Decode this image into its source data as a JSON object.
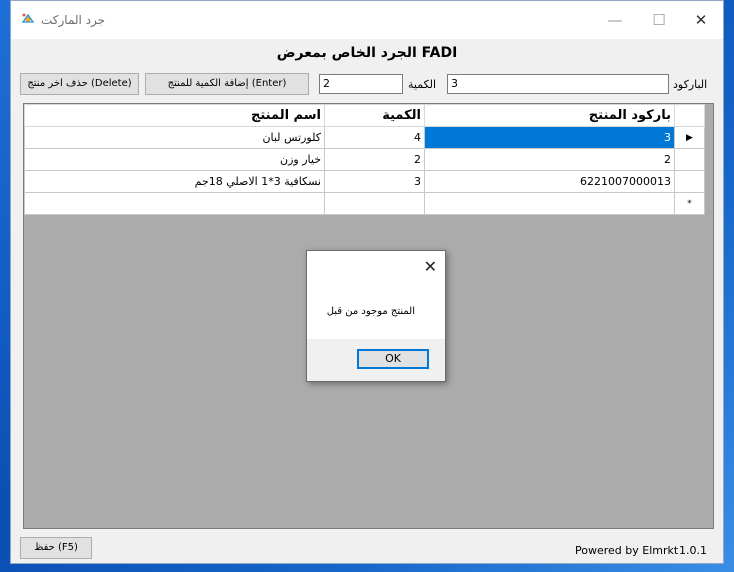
{
  "window": {
    "title": "جرد الماركت",
    "controls": {
      "minimize": "—",
      "maximize": "☐",
      "close": "✕"
    }
  },
  "header": {
    "title": "الجرد الخاص بمعرض FADI"
  },
  "form": {
    "barcode_label": "الباركود",
    "barcode_value": "3",
    "quantity_label": "الكمية",
    "quantity_value": "2",
    "add_button": "إضافة الكمية للمنتج (Enter)",
    "delete_button": "حذف اخر منتج (Delete)"
  },
  "grid": {
    "columns": [
      "باركود المنتج",
      "الكمية",
      "اسم المنتج"
    ],
    "rows": [
      {
        "barcode": "3",
        "quantity": "4",
        "name": "كلورتس لبان",
        "marker": "▶"
      },
      {
        "barcode": "2",
        "quantity": "2",
        "name": "خيار وزن",
        "marker": ""
      },
      {
        "barcode": "6221007000013",
        "quantity": "3",
        "name": "نسكافية 3*1 الاصلي 18جم",
        "marker": ""
      }
    ],
    "new_row_marker": "*"
  },
  "dialog": {
    "message": "المنتج موجود من قبل",
    "ok": "OK",
    "close": "✕"
  },
  "footer": {
    "save_button": "حفظ (F5)",
    "powered_by": "Powered by Elmrkt",
    "version": "1.0.1"
  }
}
